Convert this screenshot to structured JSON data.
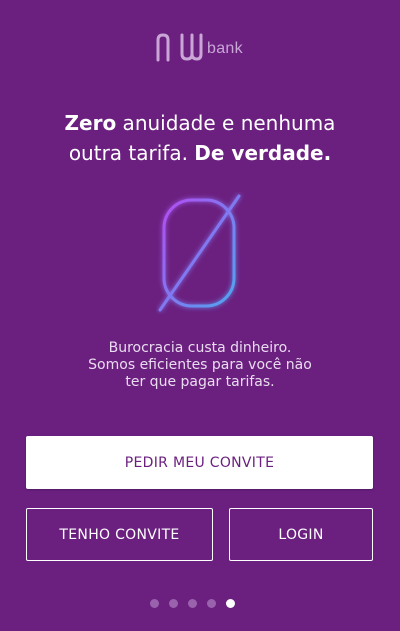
{
  "brand": {
    "logo_mark": "nu",
    "logo_word": "bank"
  },
  "headline": {
    "part1_bold": "Zero",
    "part1_rest": " anuidade e nenhuma",
    "part2_rest": "outra tarifa. ",
    "part2_bold": "De verdade."
  },
  "icon": {
    "name": "zero-slashed-icon",
    "gradient_from": "#b24cf2",
    "gradient_to": "#4fa6f0"
  },
  "subtext": {
    "line1": "Burocracia custa dinheiro.",
    "line2": "Somos eficientes para você não",
    "line3": "ter que pagar tarifas."
  },
  "buttons": {
    "primary": "PEDIR MEU CONVITE",
    "invite": "TENHO CONVITE",
    "login": "LOGIN"
  },
  "pagination": {
    "total": 5,
    "active_index": 4
  },
  "colors": {
    "background": "#6b2080",
    "primary_text": "#6b2080",
    "dot_inactive": "#9a62ad",
    "dot_active": "#ffffff"
  }
}
